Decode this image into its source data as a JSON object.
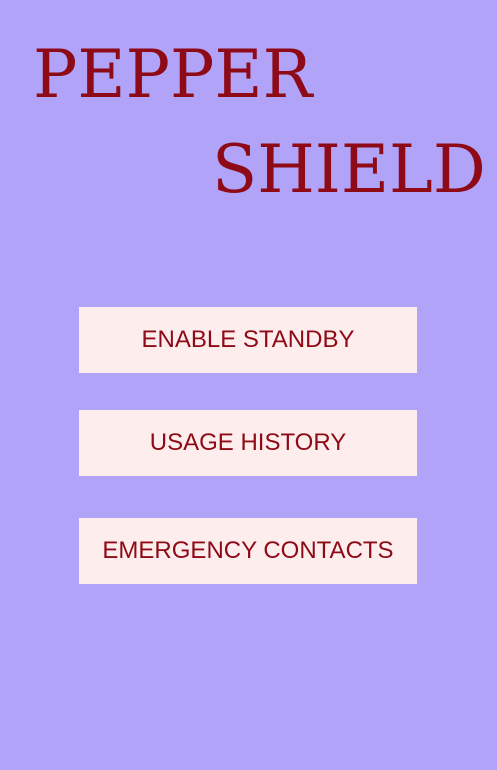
{
  "app": {
    "title_line1": "PEPPER",
    "title_line2": "SHIELD"
  },
  "menu": {
    "enable_standby": "ENABLE STANDBY",
    "usage_history": "USAGE HISTORY",
    "emergency_contacts": "EMERGENCY CONTACTS"
  },
  "colors": {
    "background": "#b1a3f8",
    "text": "#8d0a16",
    "button_bg": "#fdeded"
  }
}
